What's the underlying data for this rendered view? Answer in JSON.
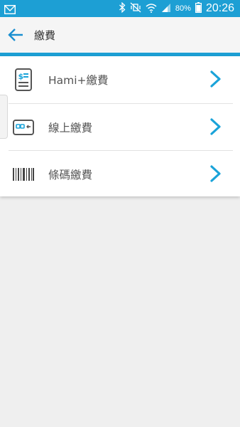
{
  "status_bar": {
    "battery_text": "80%",
    "time": "20:26",
    "icons": [
      "mail-icon",
      "bluetooth-icon",
      "mute-icon",
      "wifi-icon",
      "signal-icon",
      "battery-icon"
    ]
  },
  "app_bar": {
    "title": "繳費",
    "back_icon": "arrow-left-icon"
  },
  "menu": {
    "items": [
      {
        "label": "Hami+繳費",
        "icon": "bill-icon"
      },
      {
        "label": "線上繳費",
        "icon": "card-icon"
      },
      {
        "label": "條碼繳費",
        "icon": "barcode-icon"
      }
    ]
  },
  "colors": {
    "accent": "#1d9fd4",
    "chevron": "#1aa3d9",
    "icon_gray": "#555555",
    "background": "#efefef"
  }
}
